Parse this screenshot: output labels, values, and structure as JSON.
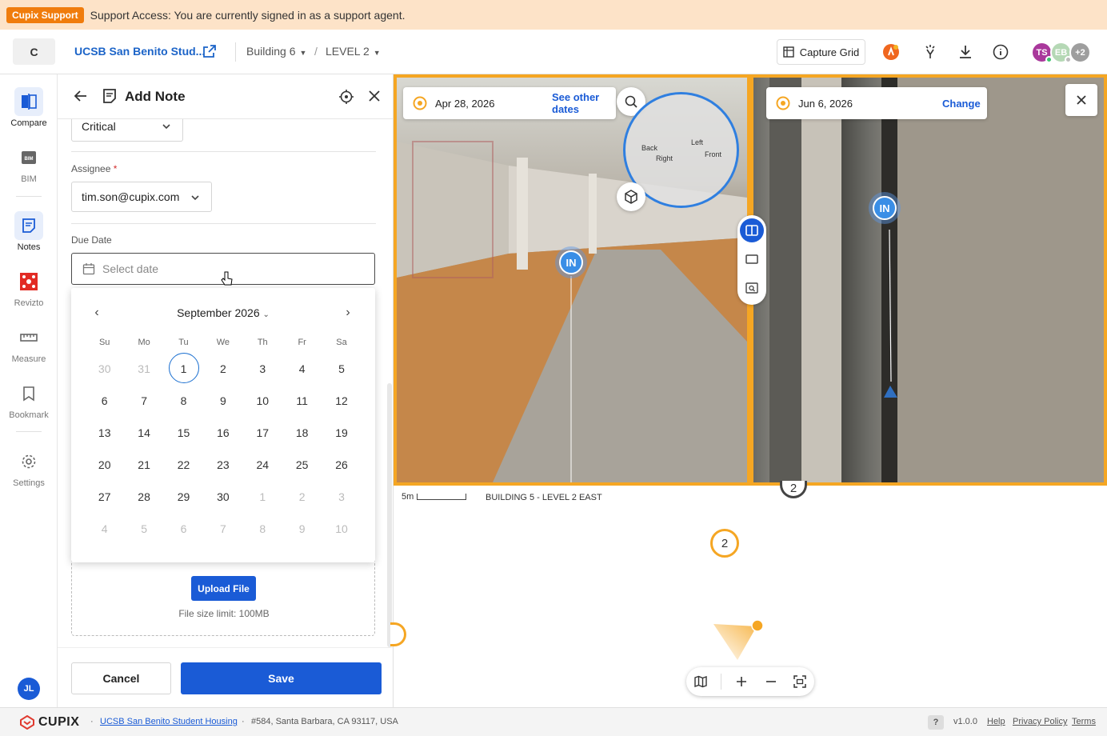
{
  "banner": {
    "tag": "Cupix Support",
    "text": "Support Access: You are currently signed in as a support agent."
  },
  "header": {
    "org_initial": "C",
    "project_name": "UCSB San Benito Stud...",
    "breadcrumb": {
      "building": "Building 6",
      "level": "LEVEL 2",
      "separator": "/"
    },
    "capture_grid_label": "Capture Grid",
    "avatars": [
      {
        "initials": "TS",
        "color": "#a9389b"
      },
      {
        "initials": "EB",
        "color": "#b5d8b5"
      },
      {
        "initials": "+2",
        "color": "#9e9e9e"
      }
    ]
  },
  "nav": {
    "items": [
      {
        "label": "Compare"
      },
      {
        "label": "BIM"
      },
      {
        "label": "Notes"
      },
      {
        "label": "Revizto"
      },
      {
        "label": "Measure"
      },
      {
        "label": "Bookmark"
      },
      {
        "label": "Settings"
      }
    ],
    "user_initials": "JL"
  },
  "panel": {
    "title": "Add Note",
    "priority_value": "Critical",
    "assignee_label": "Assignee",
    "required_mark": "*",
    "assignee_value": "tim.son@cupix.com",
    "due_date_label": "Due Date",
    "due_date_placeholder": "Select date",
    "calendar": {
      "month_label": "September 2026",
      "weekdays": [
        "Su",
        "Mo",
        "Tu",
        "We",
        "Th",
        "Fr",
        "Sa"
      ],
      "weeks": [
        [
          "30",
          "31",
          "1",
          "2",
          "3",
          "4",
          "5"
        ],
        [
          "6",
          "7",
          "8",
          "9",
          "10",
          "11",
          "12"
        ],
        [
          "13",
          "14",
          "15",
          "16",
          "17",
          "18",
          "19"
        ],
        [
          "20",
          "21",
          "22",
          "23",
          "24",
          "25",
          "26"
        ],
        [
          "27",
          "28",
          "29",
          "30",
          "1",
          "2",
          "3"
        ],
        [
          "4",
          "5",
          "6",
          "7",
          "8",
          "9",
          "10"
        ]
      ],
      "today": "1"
    },
    "upload_button": "Upload File",
    "upload_hint": "File size limit: 100MB",
    "cancel_label": "Cancel",
    "save_label": "Save"
  },
  "viewer": {
    "left": {
      "date": "Apr 28, 2026",
      "link": "See other dates",
      "pin_label": "IN"
    },
    "right": {
      "date": "Jun 6, 2026",
      "link": "Change",
      "pin_label": "IN"
    },
    "minimap_labels": {
      "back": "Back",
      "left": "Left",
      "right": "Right",
      "front": "Front"
    }
  },
  "map": {
    "scale": "5m",
    "title": "BUILDING 5 - LEVEL 2 EAST",
    "markers": [
      "2",
      "2"
    ]
  },
  "footer": {
    "brand": "CUPIX",
    "project_link": "UCSB San Benito Student Housing",
    "address": "#584, Santa Barbara, CA 93117, USA",
    "help_mark": "?",
    "version": "v1.0.0",
    "links": [
      "Help",
      "Privacy Policy",
      "Terms"
    ]
  },
  "colors": {
    "accent": "#1a5bd6",
    "support_orange": "#f07c0c",
    "viewer_frame": "#f5a623"
  }
}
